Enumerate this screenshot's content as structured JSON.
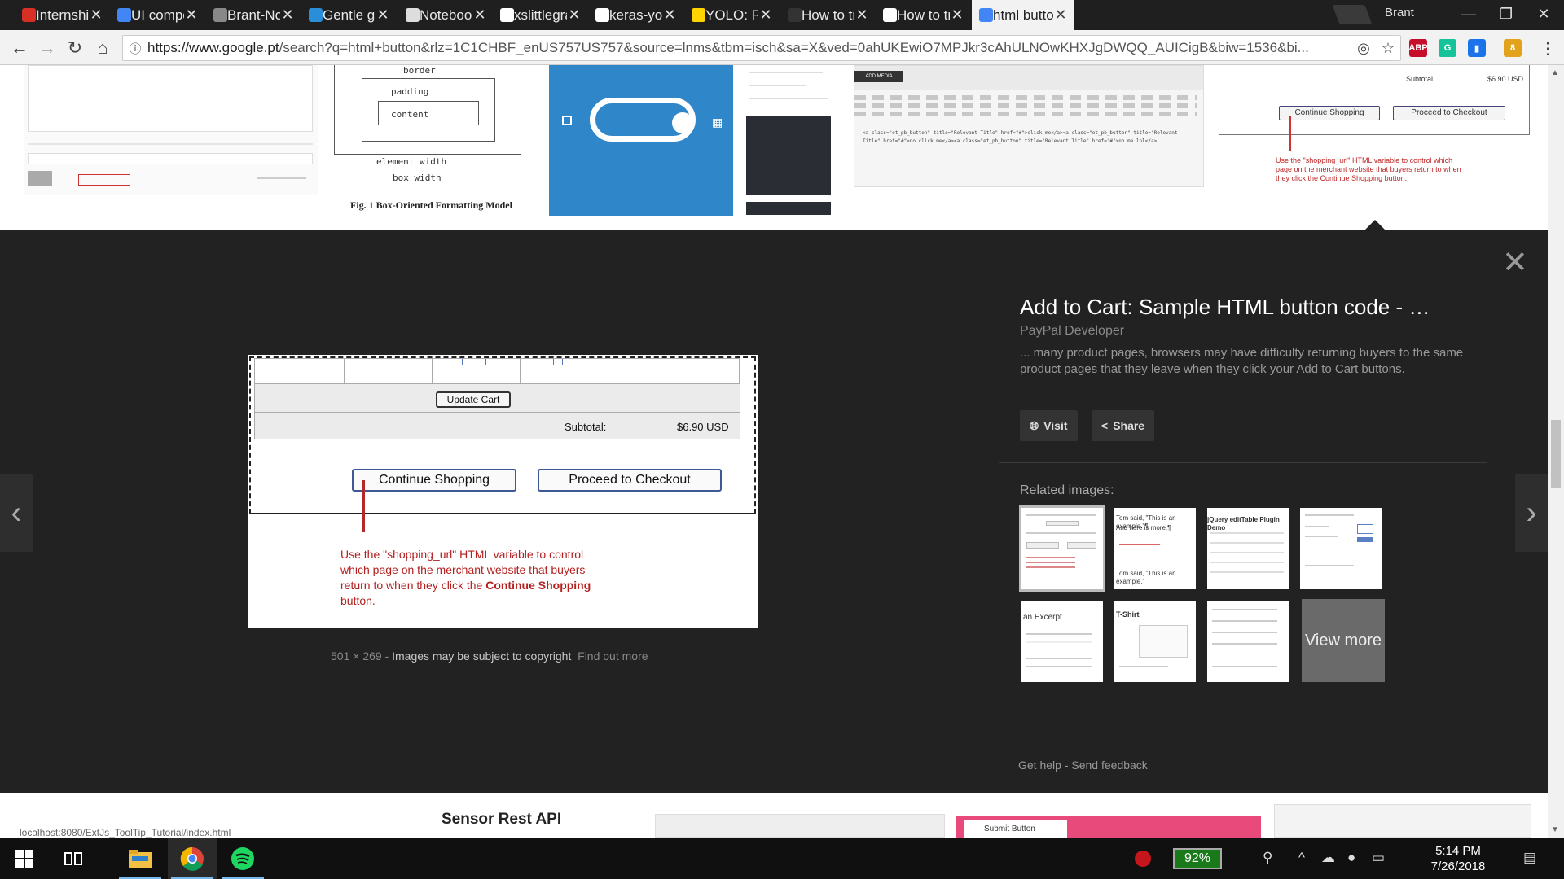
{
  "browser": {
    "tabs": [
      {
        "label": "Internship",
        "icon": "gmail-icon",
        "color": "#d93025"
      },
      {
        "label": "UI compon",
        "icon": "docs-icon",
        "color": "#4285f4"
      },
      {
        "label": "Brant-Note",
        "icon": "gear-icon",
        "color": "#888888"
      },
      {
        "label": "Gentle gui",
        "icon": "blog-icon",
        "color": "#2a8fd8"
      },
      {
        "label": "Notebook",
        "icon": "page-icon",
        "color": "#dddddd"
      },
      {
        "label": "xslittlegras",
        "icon": "github-icon",
        "color": "#ffffff"
      },
      {
        "label": "keras-yolo",
        "icon": "github-icon",
        "color": "#ffffff"
      },
      {
        "label": "YOLO: Real",
        "icon": "pj-icon",
        "color": "#ffd400"
      },
      {
        "label": "How to tra",
        "icon": "page-icon",
        "color": "#333333"
      },
      {
        "label": "How to tra",
        "icon": "medium-icon",
        "color": "#ffffff"
      },
      {
        "label": "html butto",
        "icon": "google-icon",
        "color": "#4285f4",
        "active": true
      }
    ],
    "profile_name": "Brant",
    "url_host": "https://www.google.pt",
    "url_rest": "/search?q=html+button&rlz=1C1CHBF_enUS757US757&source=lnms&tbm=isch&sa=X&ved=0ahUKEwiO7MPJkr3cAhULNOwKHXJgDWQQ_AUICigB&biw=1536&bi...",
    "extensions": [
      {
        "name": "abp-icon",
        "color": "#c70d2c",
        "text": "ABP"
      },
      {
        "name": "grammarly-icon",
        "color": "#15c39a",
        "text": "G"
      },
      {
        "name": "bookmark-ext-icon",
        "color": "#1a73e8",
        "text": "▮"
      },
      {
        "name": "badge-ext-icon",
        "color": "#e2a21b",
        "text": "8"
      }
    ]
  },
  "thumbs_top": {
    "box_model_labels": {
      "border": "border",
      "padding": "padding",
      "content": "content",
      "element_width": "element width",
      "box_width": "box width"
    },
    "box_model_caption": "Fig. 1 Box-Oriented Formatting Model",
    "paypal_subtotal_label": "Subtotal",
    "paypal_subtotal_value": "$6.90 USD",
    "paypal_continue": "Continue Shopping",
    "paypal_checkout": "Proceed to Checkout",
    "paypal_note": "Use the \"shopping_url\" HTML variable to control which page on the merchant website that buyers return to when they click the Continue Shopping button.",
    "wp_add_media": "ADD MEDIA",
    "wp_code": "<a class=\"et_pb_button\" title=\"Relevant Title\" href=\"#\">click me</a><a class=\"et_pb_button\" title=\"Relevant Title\" href=\"#\">no click me</a><a class=\"et_pb_button\" title=\"Relevant Title\" href=\"#\">no me lol</a>"
  },
  "preview": {
    "update_cart": "Update Cart",
    "subtotal_label": "Subtotal:",
    "subtotal_value": "$6.90 USD",
    "continue_shopping": "Continue Shopping",
    "proceed_checkout": "Proceed to Checkout",
    "note_prefix": "Use the \"shopping_url\" HTML variable to control which page on the merchant website that buyers return to when they click the ",
    "note_bold": "Continue Shopping",
    "note_suffix": " button.",
    "dimensions": "501 × 269",
    "separator": " - ",
    "copyright": "Images may be subject to copyright",
    "find_out_more": "Find out more"
  },
  "info": {
    "title": "Add to Cart: Sample HTML button code - …",
    "source": "PayPal Developer",
    "description": "... many product pages, browsers may have difficulty returning buyers to the same product pages that they leave when they click your Add to Cart buttons.",
    "visit": "Visit",
    "share": "Share",
    "related_label": "Related images:",
    "view_more": "View more",
    "get_help": "Get help",
    "send_feedback": "Send feedback",
    "related_snippets": {
      "r2_line1": "Tom said, \"This is an example.\"¶",
      "r2_line2": "And here is more.¶",
      "r2_line3": "Tom said, \"This is an example.\"",
      "r3_title": "jQuery editTable Plugin Demo",
      "r5_title": "an Excerpt",
      "r6_title": "T-Shirt"
    }
  },
  "below": {
    "mini_url": "localhost:8080/ExtJs_ToolTip_Tutorial/index.html",
    "sensor_title": "Sensor Rest API",
    "submit_tab": "Submit Button"
  },
  "taskbar": {
    "battery": "92%",
    "time": "5:14 PM",
    "date": "7/26/2018"
  }
}
